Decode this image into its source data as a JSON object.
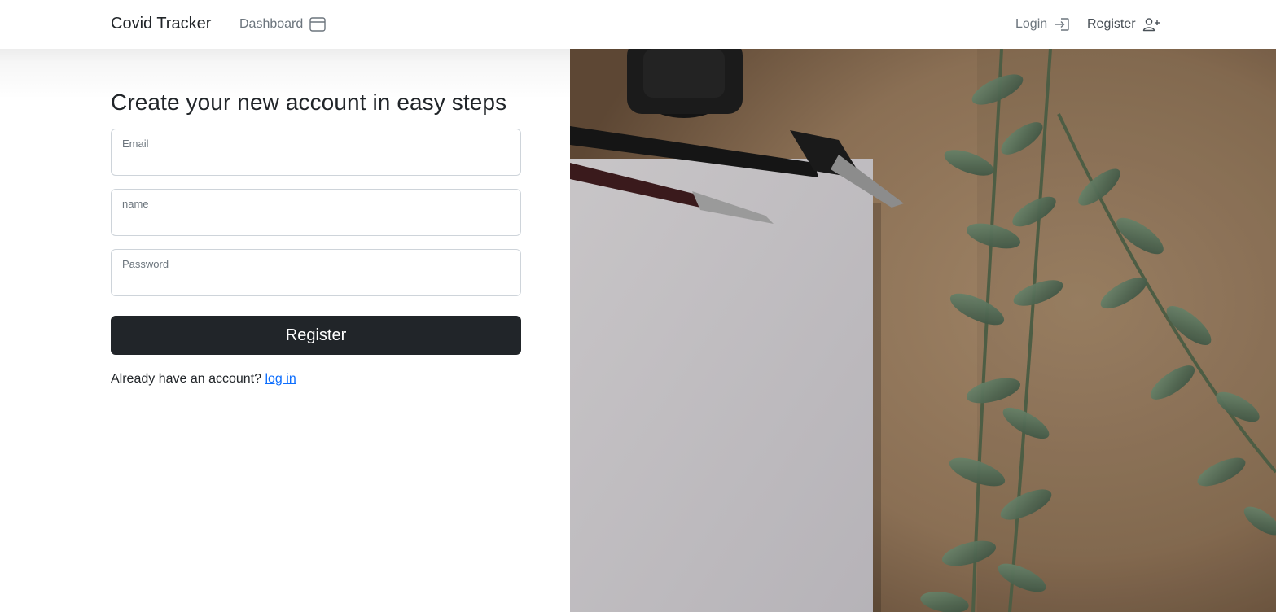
{
  "nav": {
    "brand": "Covid Tracker",
    "dashboard": "Dashboard",
    "login": "Login",
    "register": "Register"
  },
  "form": {
    "heading": "Create your new account in easy steps",
    "email_label": "Email",
    "email_value": "",
    "name_label": "name",
    "name_value": "",
    "password_label": "Password",
    "password_value": "",
    "submit": "Register",
    "already_text": "Already have an account?",
    "login_link": "log in"
  },
  "colors": {
    "button_bg": "#212529",
    "link": "#0d6efd",
    "muted_text": "#6c757d",
    "field_border": "#ced4da"
  },
  "icons": {
    "dashboard": "window-icon",
    "login": "box-arrow-in-right-icon",
    "register": "person-plus-icon"
  }
}
